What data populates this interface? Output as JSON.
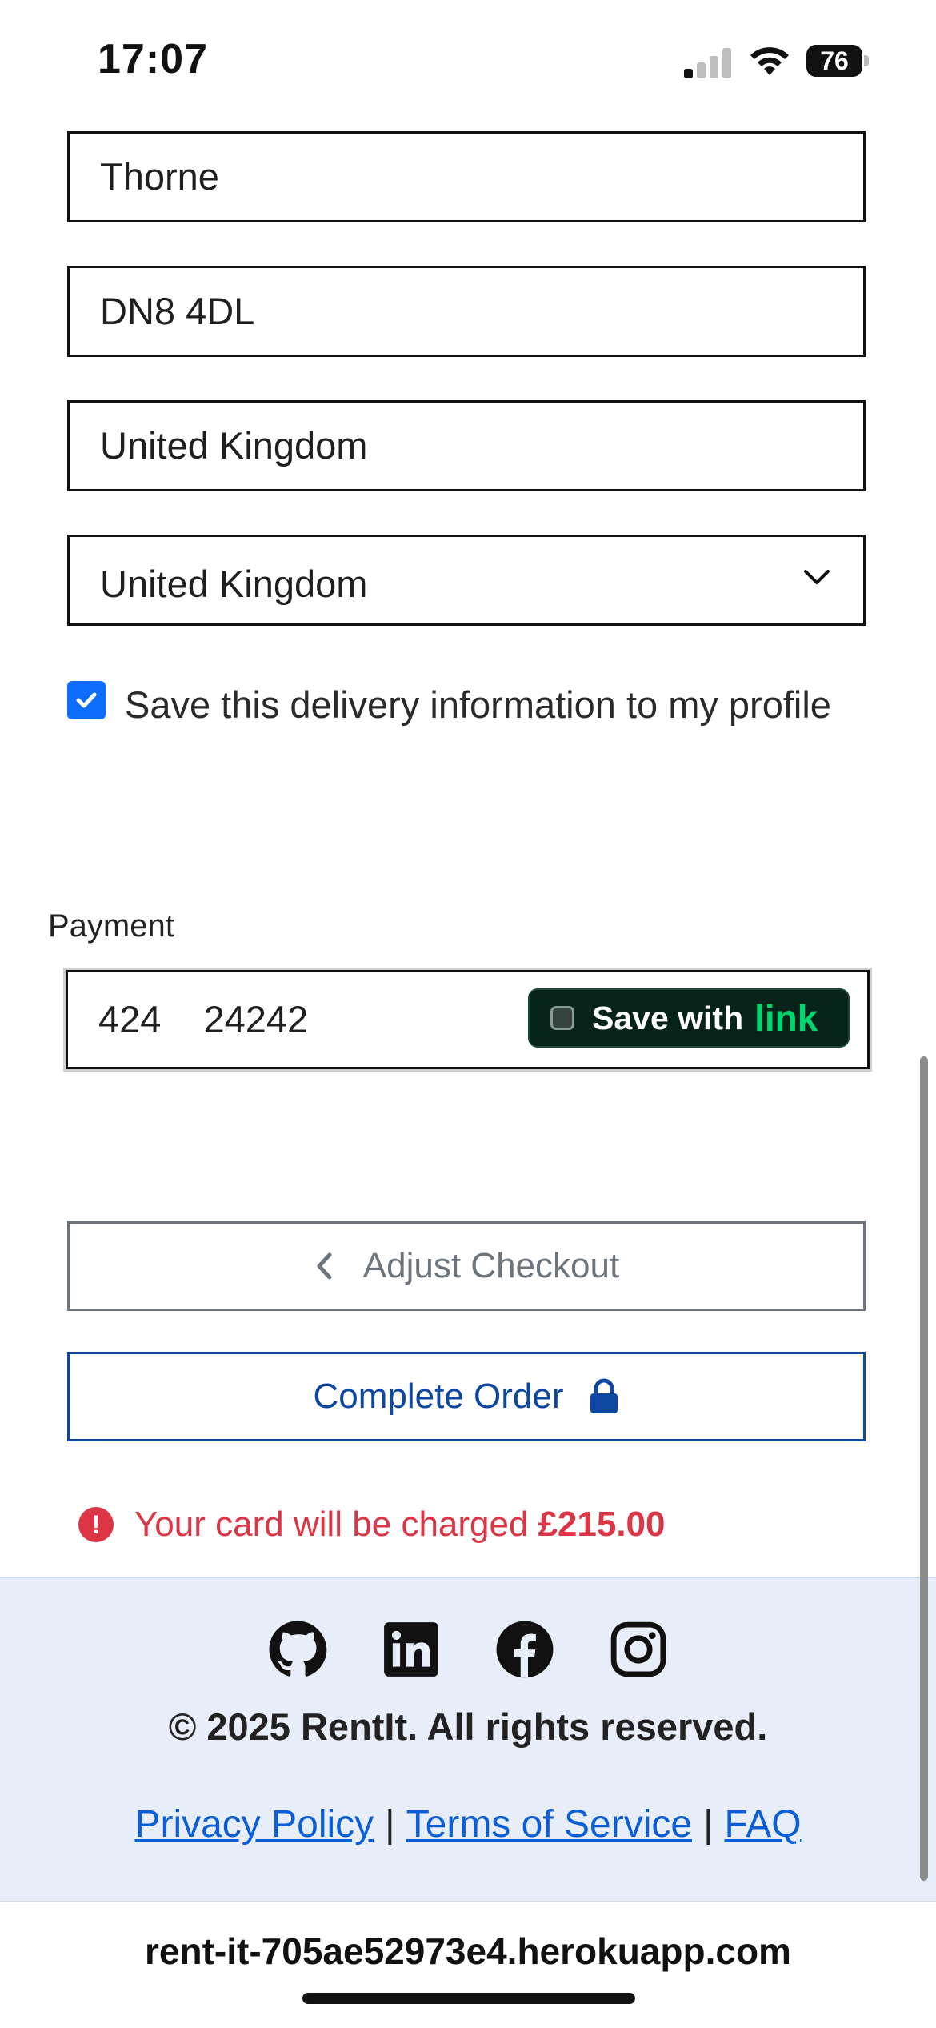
{
  "status_bar": {
    "time": "17:07",
    "battery": "76"
  },
  "form": {
    "fields": [
      {
        "value": "Thorne"
      },
      {
        "value": "DN8 4DL"
      },
      {
        "value": "United Kingdom"
      }
    ],
    "country_select": {
      "selected": "United Kingdom"
    },
    "save_info": {
      "label": "Save this delivery information to my profile",
      "checked": true
    }
  },
  "payment": {
    "label": "Payment",
    "card_number": "424 24242",
    "link_button": {
      "label": "Save with",
      "brand": "link"
    }
  },
  "buttons": {
    "adjust": "Adjust Checkout",
    "complete": "Complete Order"
  },
  "charge": {
    "text": "Your card will be charged",
    "amount": "£215.00"
  },
  "footer": {
    "social_icons": [
      "github-icon",
      "linkedin-icon",
      "facebook-icon",
      "instagram-icon"
    ],
    "copyright": "© 2025 RentIt. All rights reserved.",
    "links": [
      "Privacy Policy",
      "Terms of Service",
      "FAQ"
    ],
    "separator": "|"
  },
  "browser": {
    "url": "rent-it-705ae52973e4.herokuapp.com"
  },
  "colors": {
    "primary": "#0d6efd",
    "danger": "#dc3545",
    "link_green": "#00d66f",
    "footer_bg": "#e8eef9"
  }
}
